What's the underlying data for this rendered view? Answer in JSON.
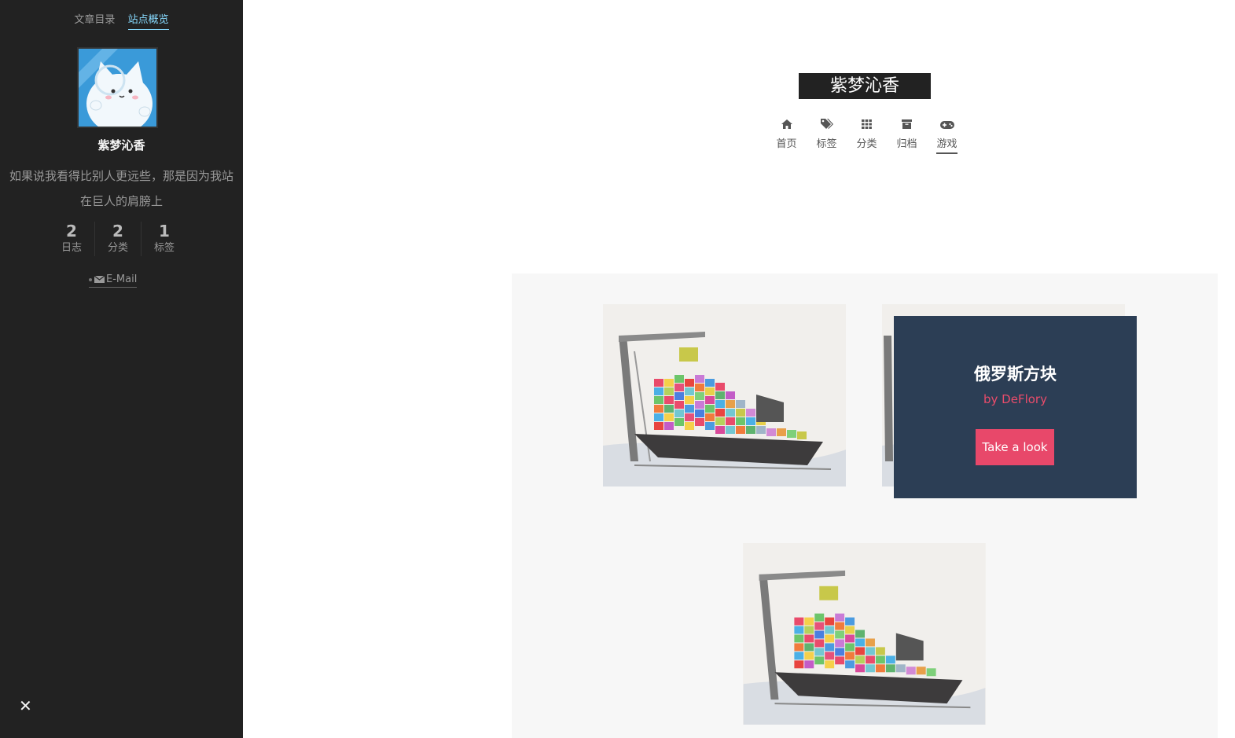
{
  "sidebar": {
    "tabs": [
      "文章目录",
      "站点概览"
    ],
    "author": "紫梦沁香",
    "description": "如果说我看得比别人更远些，那是因为我站在巨人的肩膀上",
    "stats": [
      {
        "count": "2",
        "label": "日志"
      },
      {
        "count": "2",
        "label": "分类"
      },
      {
        "count": "1",
        "label": "标签"
      }
    ],
    "email_label": "E-Mail",
    "close_label": "✕"
  },
  "header": {
    "site_title": "紫梦沁香",
    "menu": [
      {
        "label": "首页",
        "icon": "home-icon"
      },
      {
        "label": "标签",
        "icon": "tags-icon"
      },
      {
        "label": "分类",
        "icon": "th-icon"
      },
      {
        "label": "归档",
        "icon": "archive-icon"
      },
      {
        "label": "游戏",
        "icon": "gamepad-icon"
      }
    ]
  },
  "games": {
    "overlay": {
      "title": "俄罗斯方块",
      "author": "by DeFlory",
      "button": "Take a look"
    }
  },
  "colors": {
    "sidebar_bg": "#222222",
    "active_tab": "#87daff",
    "overlay_bg": "#2c3e55",
    "accent": "#e8486a"
  }
}
